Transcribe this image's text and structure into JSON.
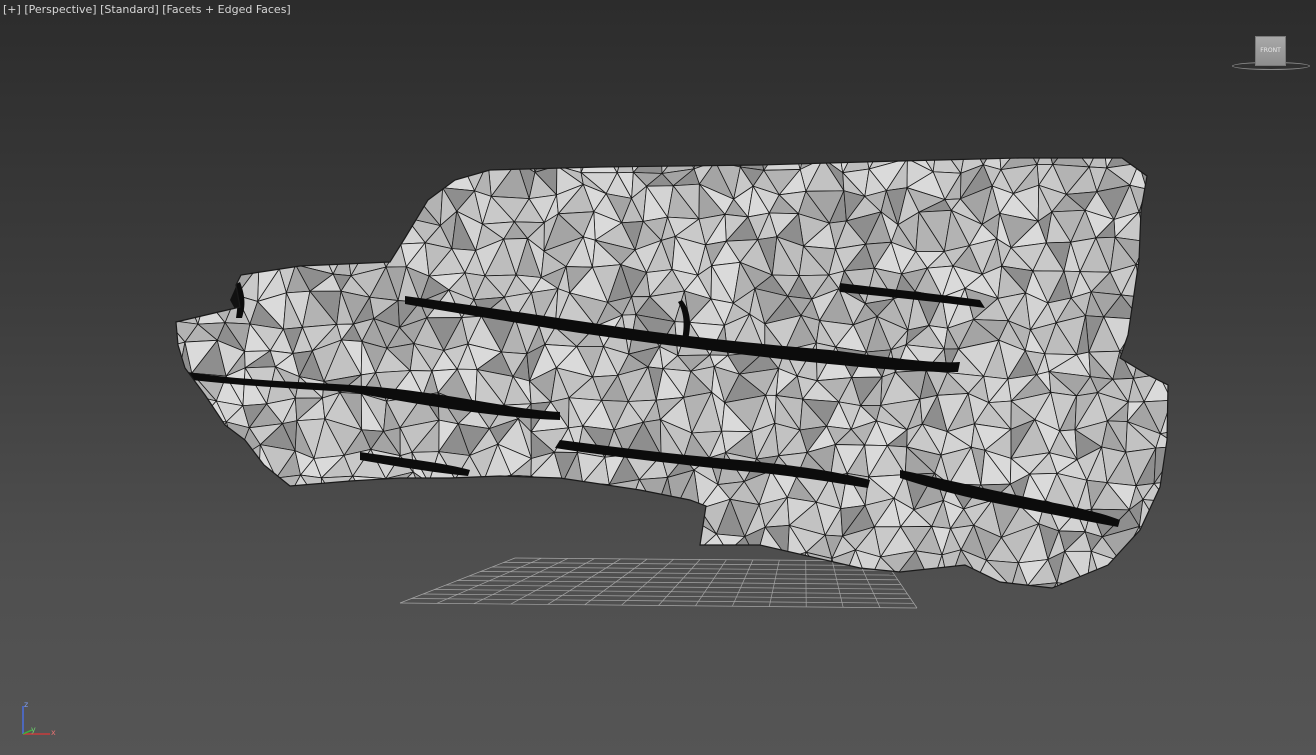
{
  "viewport": {
    "label_parts": [
      "[+]",
      "[Perspective]",
      "[Standard]",
      "[Facets + Edged Faces]"
    ],
    "view_type": "Perspective",
    "shading_mode": "Facets + Edged Faces"
  },
  "viewcube": {
    "face_label": "FRONT"
  },
  "axis_tripod": {
    "z_label": "z",
    "y_label": "y",
    "x_label": "x",
    "colors": {
      "x": "#c83c3c",
      "y": "#3cb43c",
      "z": "#4b6ee0"
    }
  },
  "colors": {
    "mesh_face": "#bdbdbd",
    "mesh_face_dark": "#8c8c8c",
    "mesh_edge": "#1a1a1a",
    "grid_line": "#a5a5a5",
    "text": "#d6d6d6"
  },
  "icons": [
    "viewcube-icon",
    "axis-tripod-icon"
  ]
}
